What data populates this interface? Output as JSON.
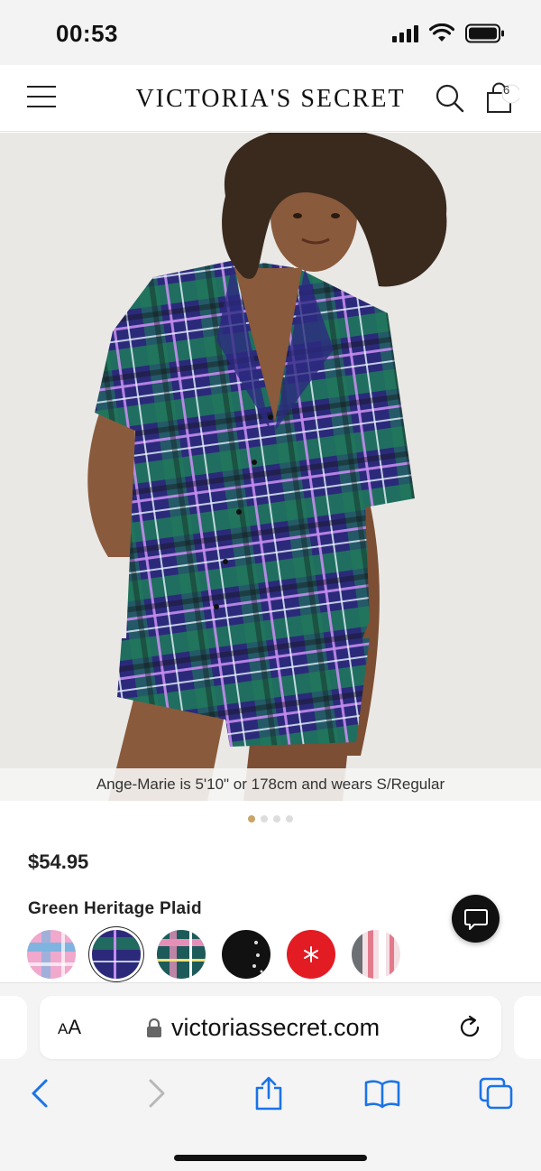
{
  "status_bar": {
    "time": "00:53",
    "icons": [
      "signal-icon",
      "wifi-icon",
      "battery-icon"
    ]
  },
  "header": {
    "brand": "VICTORIA'S SECRET",
    "bag_count": "6",
    "icons": [
      "menu-icon",
      "search-icon",
      "shopping-bag-icon"
    ]
  },
  "product": {
    "image_caption": "Ange-Marie is 5'10\" or 178cm and wears S/Regular",
    "carousel": {
      "total": 4,
      "active": 1
    },
    "price": "$54.95",
    "color_name": "Green Heritage Plaid",
    "swatches": [
      {
        "name": "pink-blue-plaid",
        "selected": false
      },
      {
        "name": "green-heritage-plaid",
        "selected": true
      },
      {
        "name": "teal-pink-plaid",
        "selected": false
      },
      {
        "name": "black-print",
        "selected": false
      },
      {
        "name": "red-snowflake",
        "selected": false
      },
      {
        "name": "pink-gray-stripe",
        "selected": false
      }
    ]
  },
  "browser": {
    "text_size_label_small": "A",
    "text_size_label_large": "A",
    "url": "victoriassecret.com",
    "toolbar": [
      "back-icon",
      "forward-icon",
      "share-icon",
      "bookmarks-icon",
      "tabs-icon"
    ]
  },
  "colors": {
    "accent_dot": "#c9a56a",
    "link_blue": "#1a73e8",
    "plaid_navy": "#2b2a7a",
    "plaid_green": "#1f7a5a"
  }
}
